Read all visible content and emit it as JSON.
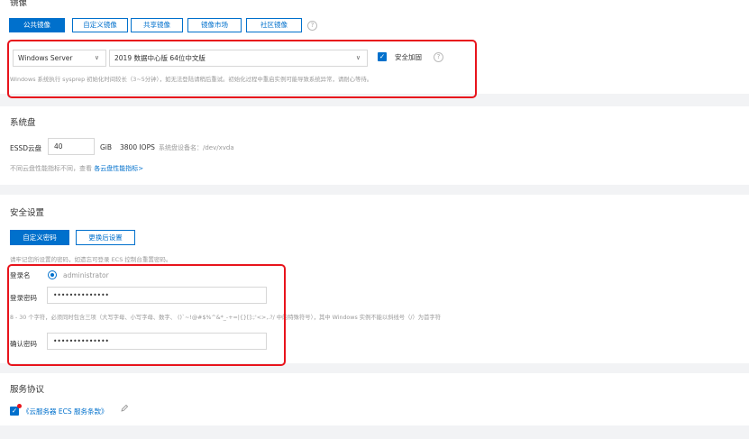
{
  "image_section": {
    "title": "镜像",
    "tabs": [
      {
        "label": "公共镜像",
        "active": true
      },
      {
        "label": "自定义镜像",
        "active": false
      },
      {
        "label": "共享镜像",
        "active": false
      },
      {
        "label": "镜像市场",
        "active": false
      },
      {
        "label": "社区镜像",
        "active": false
      }
    ],
    "os_select": "Windows Server",
    "version_select": "2019 数据中心版 64位中文版",
    "security_hardening": {
      "label": "安全加固",
      "checked": true
    },
    "note": "Windows 系统执行 sysprep 初始化时间较长（3~5分钟），如无法登陆请稍后重试。初始化过程中重启实例可能导致系统异常，请耐心等待。"
  },
  "system_disk": {
    "title": "系统盘",
    "disk_type": "ESSD云盘",
    "size": "40",
    "size_unit": "GiB",
    "iops": "3800 IOPS",
    "device_label": "系统盘设备名：/dev/xvda",
    "perf_note": "不同云盘性能指标不同，查看",
    "perf_link": "各云盘性能指标>"
  },
  "security": {
    "title": "安全设置",
    "btn_custom_password": "自定义密码",
    "btn_set_later": "更换后设置",
    "hint": "请牢记您所设置的密码，如遗忘可登录 ECS 控制台重置密码。",
    "login_name_label": "登录名",
    "login_name_value": "administrator",
    "password_label": "登录密码",
    "password_value": "••••••••••••••",
    "password_rule": "8 - 30 个字符，必须同时包含三项（大写字母、小写字母、数字、 ()`~!@#$%^&*_-+=|{}[]:;'<>,.?/ 中的特殊符号），其中 Windows 实例不能以斜线号（/）为首字符",
    "confirm_label": "确认密码",
    "confirm_value": "••••••••••••••"
  },
  "agreement": {
    "title": "服务协议",
    "link_text": "《云服务器 ECS 服务条款》",
    "checked": true
  },
  "colors": {
    "accent": "#0070cc",
    "highlight": "#e8141c"
  }
}
